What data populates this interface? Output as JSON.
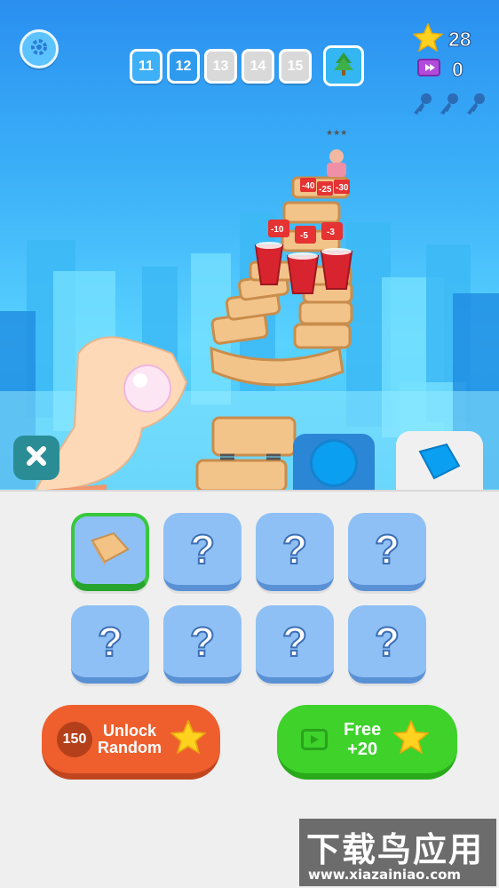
{
  "hud": {
    "levels": [
      "11",
      "12",
      "13",
      "14",
      "15"
    ],
    "current_level": "12",
    "stars": "28",
    "tickets": "0",
    "keys_count": 3
  },
  "shop": {
    "cells": [
      {
        "type": "tile",
        "label": ""
      },
      {
        "type": "locked",
        "label": "?"
      },
      {
        "type": "locked",
        "label": "?"
      },
      {
        "type": "locked",
        "label": "?"
      },
      {
        "type": "locked",
        "label": "?"
      },
      {
        "type": "locked",
        "label": "?"
      },
      {
        "type": "locked",
        "label": "?"
      },
      {
        "type": "locked",
        "label": "?"
      }
    ],
    "unlock_price": "150",
    "unlock_label_1": "Unlock",
    "unlock_label_2": "Random",
    "free_label_1": "Free",
    "free_label_2": "+20"
  },
  "track_signs": [
    "-40",
    "-25",
    "-30",
    "-10",
    "-5",
    "-3"
  ],
  "watermark": {
    "title": "下载鸟应用",
    "url": "www.xiazainiao.com"
  },
  "colors": {
    "sky": "#2fb6f5",
    "unlock_button": "#ef5f2d",
    "free_button": "#3ed22b",
    "locked_cell": "#8ec0f5",
    "selected_border": "#36c93c"
  }
}
